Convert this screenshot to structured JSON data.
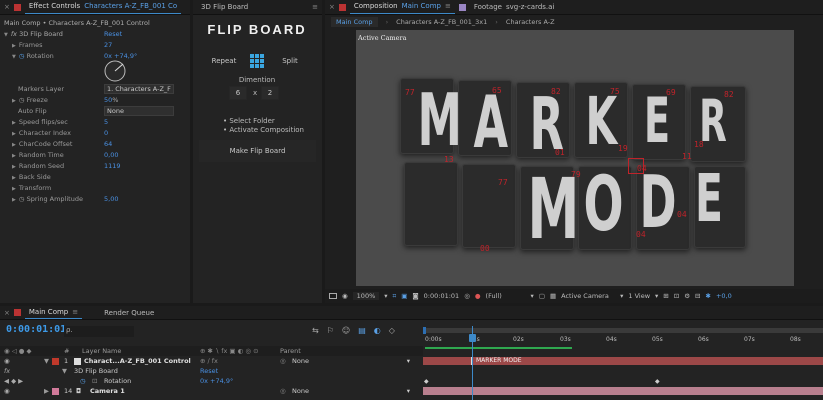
{
  "effect_controls": {
    "tab_title": "Effect Controls",
    "tab_layer": "Characters A-Z_FB_001 Co",
    "breadcrumb": "Main Comp • Characters A-Z_FB_001 Control",
    "effect_name": "3D Flip Board",
    "reset": "Reset",
    "params": [
      {
        "label": "Frames",
        "value": "27"
      },
      {
        "label": "Rotation",
        "value": "0x +74,9°"
      },
      {
        "label": "Markers Layer",
        "value": "1. Characters A-Z_F"
      },
      {
        "label": "Freeze",
        "value": "50",
        "unit": "%"
      },
      {
        "label": "Auto Flip",
        "value": "None"
      },
      {
        "label": "Speed flips/sec",
        "value": "5"
      },
      {
        "label": "Character Index",
        "value": "0"
      },
      {
        "label": "CharCode Offset",
        "value": "64"
      },
      {
        "label": "Random Time",
        "value": "0,00"
      },
      {
        "label": "Random Seed",
        "value": "1119"
      },
      {
        "label": "Back Side",
        "value": ""
      },
      {
        "label": "Transform",
        "value": ""
      },
      {
        "label": "Spring Amplitude",
        "value": "5,00"
      }
    ]
  },
  "flip_board_panel": {
    "tab_title": "3D Flip Board",
    "logo_text": "FLIP BOARD",
    "repeat_label": "Repeat",
    "split_label": "Split",
    "dimension_label": "Dimention",
    "dim_x": "6",
    "dim_sep": "x",
    "dim_y": "2",
    "bullets": [
      "Select Folder",
      "Activate Composition"
    ],
    "make_button": "Make Flip Board"
  },
  "composition": {
    "tab_prefix": "Composition",
    "tab_name": "Main Comp",
    "footage_tab": "Footage",
    "footage_name": "svg-z-cards.ai",
    "subtabs": [
      "Main Comp",
      "Characters A-Z_FB_001_3x1",
      "Characters A-Z"
    ],
    "active_camera_label": "Active Camera",
    "board_row1": [
      "M",
      "A",
      "R",
      "K",
      "E",
      "R"
    ],
    "board_row2": [
      "M",
      "O",
      "D",
      "E"
    ],
    "red_numbers": [
      "77",
      "65",
      "82",
      "75",
      "69",
      "82",
      "13",
      "01",
      "19",
      "18",
      "11",
      "77",
      "79",
      "04",
      "04",
      "00",
      "04"
    ],
    "toolbar": {
      "zoom": "100%",
      "timecode": "0:00:01:01",
      "resolution": "(Full)",
      "camera": "Active Camera",
      "view": "1 View",
      "exposure": "+0,0"
    }
  },
  "timeline": {
    "tabs": [
      "Main Comp",
      "Render Queue"
    ],
    "timecode": "0:00:01:01",
    "search_placeholder": "ρ.",
    "header": {
      "num": "#",
      "layer_name": "Layer Name",
      "parent": "Parent"
    },
    "layers": [
      {
        "num": "1",
        "name": "Charact...A-Z_FB_001 Control",
        "parent": "None",
        "color": "#c0392b"
      },
      {
        "num": "",
        "name": "3D Flip Board",
        "reset": "Reset"
      },
      {
        "num": "",
        "name": "Rotation",
        "value": "0x +74,9°"
      },
      {
        "num": "14",
        "name": "Camera 1",
        "parent": "None",
        "color": "#d17a9a"
      }
    ],
    "ruler": [
      "0:00s",
      "01s",
      "02s",
      "03s",
      "04s",
      "05s",
      "06s",
      "07s",
      "08s"
    ],
    "marker_label": "MARKER MODE"
  },
  "colors": {
    "accent": "#3d89c8",
    "value_blue": "#4a90e2",
    "red": "#c0232a",
    "layer_red": "#9c4848",
    "layer_pink": "#b87f8e"
  }
}
